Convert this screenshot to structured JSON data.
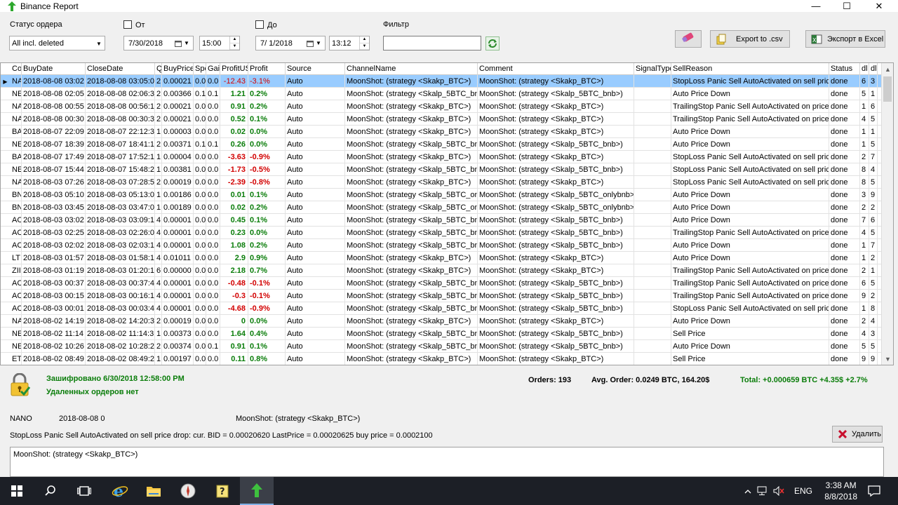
{
  "window": {
    "title": "Binance Report",
    "minimize": "—",
    "maximize": "☐",
    "close": "✕"
  },
  "filters": {
    "order_status_label": "Статус ордера",
    "order_status_value": "All incl. deleted",
    "from_label": "От",
    "from_date": "7/30/2018",
    "from_time": "15:00",
    "to_label": "До",
    "to_date": "7/ 1/2018",
    "to_time": "13:12",
    "filter_label": "Фильтр",
    "filter_value": "",
    "export_csv_label": "Export to .csv",
    "export_excel_label": "Экспорт в Excel"
  },
  "grid": {
    "columns": [
      "Co",
      "BuyDate",
      "CloseDate",
      "Q",
      "BuyPrice",
      "Spe",
      "Gai",
      "ProfitUS",
      "Profit",
      "Source",
      "ChannelName",
      "Comment",
      "SignalType",
      "SellReason",
      "Status",
      "dl",
      "dl"
    ],
    "rows": [
      [
        "NA",
        "2018-08-08 03:02",
        "2018-08-08 03:05:0",
        "2",
        "0.00021",
        "0.0",
        "0.0",
        "-12.43",
        "-3.1%",
        "Auto",
        "MoonShot: (strategy <Skakp_BTC>)",
        "MoonShot: (strategy <Skakp_BTC>)",
        "",
        "StopLoss Panic Sell AutoActivated on sell price",
        "done",
        "6",
        "3"
      ],
      [
        "NE",
        "2018-08-08 02:05",
        "2018-08-08 02:06:3",
        "2",
        "0.00366",
        "0.1",
        "0.1",
        "1.21",
        "0.2%",
        "Auto",
        "MoonShot: (strategy <Skalp_5BTC_bn",
        "MoonShot: (strategy <Skalp_5BTC_bnb>)",
        "",
        "Auto Price Down",
        "done",
        "5",
        "1"
      ],
      [
        "NA",
        "2018-08-08 00:55",
        "2018-08-08 00:56:1",
        "2",
        "0.00021",
        "0.0",
        "0.0",
        "0.91",
        "0.2%",
        "Auto",
        "MoonShot: (strategy <Skakp_BTC>)",
        "MoonShot: (strategy <Skakp_BTC>)",
        "",
        "TrailingStop Panic Sell AutoActivated on price c",
        "done",
        "1",
        "6"
      ],
      [
        "NA",
        "2018-08-08 00:30",
        "2018-08-08 00:30:3",
        "2",
        "0.00021",
        "0.0",
        "0.0",
        "0.52",
        "0.1%",
        "Auto",
        "MoonShot: (strategy <Skakp_BTC>)",
        "MoonShot: (strategy <Skakp_BTC>)",
        "",
        "TrailingStop Panic Sell AutoActivated on price c",
        "done",
        "4",
        "5"
      ],
      [
        "BA",
        "2018-08-07 22:09",
        "2018-08-07 22:12:3",
        "1",
        "0.00003",
        "0.0",
        "0.0",
        "0.02",
        "0.0%",
        "Auto",
        "MoonShot: (strategy <Skakp_BTC>)",
        "MoonShot: (strategy <Skakp_BTC>)",
        "",
        "Auto Price Down",
        "done",
        "1",
        "1"
      ],
      [
        "NE",
        "2018-08-07 18:39",
        "2018-08-07 18:41:1",
        "2",
        "0.00371",
        "0.1",
        "0.1",
        "0.26",
        "0.0%",
        "Auto",
        "MoonShot: (strategy <Skalp_5BTC_bn",
        "MoonShot: (strategy <Skalp_5BTC_bnb>)",
        "",
        "Auto Price Down",
        "done",
        "1",
        "5"
      ],
      [
        "BA",
        "2018-08-07 17:49",
        "2018-08-07 17:52:1",
        "1",
        "0.00004",
        "0.0",
        "0.0",
        "-3.63",
        "-0.9%",
        "Auto",
        "MoonShot: (strategy <Skakp_BTC>)",
        "MoonShot: (strategy <Skakp_BTC>)",
        "",
        "StopLoss Panic Sell AutoActivated on sell price",
        "done",
        "2",
        "7"
      ],
      [
        "NE",
        "2018-08-07 15:44",
        "2018-08-07 15:48:2",
        "1",
        "0.00381",
        "0.0",
        "0.0",
        "-1.73",
        "-0.5%",
        "Auto",
        "MoonShot: (strategy <Skalp_5BTC_bn",
        "MoonShot: (strategy <Skalp_5BTC_bnb>)",
        "",
        "StopLoss Panic Sell AutoActivated on sell price",
        "done",
        "8",
        "4"
      ],
      [
        "NA",
        "2018-08-03 07:26",
        "2018-08-03 07:28:5",
        "2",
        "0.00019",
        "0.0",
        "0.0",
        "-2.39",
        "-0.8%",
        "Auto",
        "MoonShot: (strategy <Skakp_BTC>)",
        "MoonShot: (strategy <Skakp_BTC>)",
        "",
        "StopLoss Panic Sell AutoActivated on sell price",
        "done",
        "8",
        "5"
      ],
      [
        "BN",
        "2018-08-03 05:10",
        "2018-08-03 05:13:0",
        "1",
        "0.00186",
        "0.0",
        "0.0",
        "0.01",
        "0.1%",
        "Auto",
        "MoonShot: (strategy <Skalp_5BTC_on",
        "MoonShot: (strategy <Skalp_5BTC_onlybnb>",
        "",
        "Auto Price Down",
        "done",
        "3",
        "9"
      ],
      [
        "BN",
        "2018-08-03 03:45",
        "2018-08-03 03:47:0",
        "1",
        "0.00189",
        "0.0",
        "0.0",
        "0.02",
        "0.2%",
        "Auto",
        "MoonShot: (strategy <Skalp_5BTC_on",
        "MoonShot: (strategy <Skalp_5BTC_onlybnb>",
        "",
        "Auto Price Down",
        "done",
        "2",
        "2"
      ],
      [
        "AC",
        "2018-08-03 03:02",
        "2018-08-03 03:09:1",
        "4",
        "0.00001",
        "0.0",
        "0.0",
        "0.45",
        "0.1%",
        "Auto",
        "MoonShot: (strategy <Skalp_5BTC_bn",
        "MoonShot: (strategy <Skalp_5BTC_bnb>)",
        "",
        "Auto Price Down",
        "done",
        "7",
        "6"
      ],
      [
        "AC",
        "2018-08-03 02:25",
        "2018-08-03 02:26:0",
        "4",
        "0.00001",
        "0.0",
        "0.0",
        "0.23",
        "0.0%",
        "Auto",
        "MoonShot: (strategy <Skalp_5BTC_bn",
        "MoonShot: (strategy <Skalp_5BTC_bnb>)",
        "",
        "TrailingStop Panic Sell AutoActivated on price c",
        "done",
        "4",
        "5"
      ],
      [
        "AC",
        "2018-08-03 02:02",
        "2018-08-03 02:03:1",
        "4",
        "0.00001",
        "0.0",
        "0.0",
        "1.08",
        "0.2%",
        "Auto",
        "MoonShot: (strategy <Skalp_5BTC_bn",
        "MoonShot: (strategy <Skalp_5BTC_bnb>)",
        "",
        "Auto Price Down",
        "done",
        "1",
        "7"
      ],
      [
        "LT",
        "2018-08-03 01:57",
        "2018-08-03 01:58:1",
        "4",
        "0.01011",
        "0.0",
        "0.0",
        "2.9",
        "0.9%",
        "Auto",
        "MoonShot: (strategy <Skakp_BTC>)",
        "MoonShot: (strategy <Skakp_BTC>)",
        "",
        "Auto Price Down",
        "done",
        "1",
        "2"
      ],
      [
        "ZII",
        "2018-08-03 01:19",
        "2018-08-03 01:20:1",
        "6",
        "0.00000",
        "0.0",
        "0.0",
        "2.18",
        "0.7%",
        "Auto",
        "MoonShot: (strategy <Skakp_BTC>)",
        "MoonShot: (strategy <Skakp_BTC>)",
        "",
        "TrailingStop Panic Sell AutoActivated on price c",
        "done",
        "2",
        "1"
      ],
      [
        "AC",
        "2018-08-03 00:37",
        "2018-08-03 00:37:4",
        "4",
        "0.00001",
        "0.0",
        "0.0",
        "-0.48",
        "-0.1%",
        "Auto",
        "MoonShot: (strategy <Skalp_5BTC_bn",
        "MoonShot: (strategy <Skalp_5BTC_bnb>)",
        "",
        "TrailingStop Panic Sell AutoActivated on price c",
        "done",
        "6",
        "5"
      ],
      [
        "AC",
        "2018-08-03 00:15",
        "2018-08-03 00:16:1",
        "4",
        "0.00001",
        "0.0",
        "0.0",
        "-0.3",
        "-0.1%",
        "Auto",
        "MoonShot: (strategy <Skalp_5BTC_bn",
        "MoonShot: (strategy <Skalp_5BTC_bnb>)",
        "",
        "TrailingStop Panic Sell AutoActivated on price c",
        "done",
        "9",
        "2"
      ],
      [
        "AC",
        "2018-08-03 00:01",
        "2018-08-03 00:03:4",
        "4",
        "0.00001",
        "0.0",
        "0.0",
        "-4.68",
        "-0.9%",
        "Auto",
        "MoonShot: (strategy <Skalp_5BTC_bn",
        "MoonShot: (strategy <Skalp_5BTC_bnb>)",
        "",
        "StopLoss Panic Sell AutoActivated on sell price",
        "done",
        "1",
        "8"
      ],
      [
        "NA",
        "2018-08-02 14:19",
        "2018-08-02 14:20:3",
        "2",
        "0.00019",
        "0.0",
        "0.0",
        "0",
        "0.0%",
        "Auto",
        "MoonShot: (strategy <Skakp_BTC>)",
        "MoonShot: (strategy <Skakp_BTC>)",
        "",
        "Auto Price Down",
        "done",
        "2",
        "4"
      ],
      [
        "NE",
        "2018-08-02 11:14",
        "2018-08-02 11:14:3",
        "1",
        "0.00373",
        "0.0",
        "0.0",
        "1.64",
        "0.4%",
        "Auto",
        "MoonShot: (strategy <Skalp_5BTC_bn",
        "MoonShot: (strategy <Skalp_5BTC_bnb>)",
        "",
        "Sell Price",
        "done",
        "4",
        "3"
      ],
      [
        "NE",
        "2018-08-02 10:26",
        "2018-08-02 10:28:2",
        "2",
        "0.00374",
        "0.0",
        "0.1",
        "0.91",
        "0.1%",
        "Auto",
        "MoonShot: (strategy <Skalp_5BTC_bn",
        "MoonShot: (strategy <Skalp_5BTC_bnb>)",
        "",
        "Auto Price Down",
        "done",
        "5",
        "5"
      ],
      [
        "ET",
        "2018-08-02 08:49",
        "2018-08-02 08:49:2",
        "1",
        "0.00197",
        "0.0",
        "0.0",
        "0.11",
        "0.8%",
        "Auto",
        "MoonShot: (strategy <Skakp_BTC>)",
        "MoonShot: (strategy <Skakp_BTC>)",
        "",
        "Sell Price",
        "done",
        "9",
        "9"
      ]
    ]
  },
  "status": {
    "encrypted": "Зашифровано 6/30/2018 12:58:00 PM",
    "deleted": "Удаленных ордеров нет",
    "orders": "Orders: 193",
    "avg_order": "Avg. Order:  0.0249 BTC,  164.20$",
    "total": "Total: +0.000659 BTC  +4.35$  +2.7%"
  },
  "detail": {
    "coin": "NANO",
    "date": "2018-08-08 0",
    "channel": "MoonShot: (strategy <Skakp_BTC>)",
    "reason": "StopLoss Panic Sell AutoActivated on sell price drop: cur. BID = 0.00020620 LastPrice = 0.00020625 buy price = 0.0002100",
    "delete_label": "Удалить",
    "memo": "MoonShot: (strategy <Skakp_BTC>)"
  },
  "taskbar": {
    "lang": "ENG",
    "time": "3:38 AM",
    "date": "8/8/2018"
  },
  "colors": {
    "profit_positive": "#0a7d0a",
    "profit_negative": "#d20000",
    "selection": "#99ccff"
  }
}
